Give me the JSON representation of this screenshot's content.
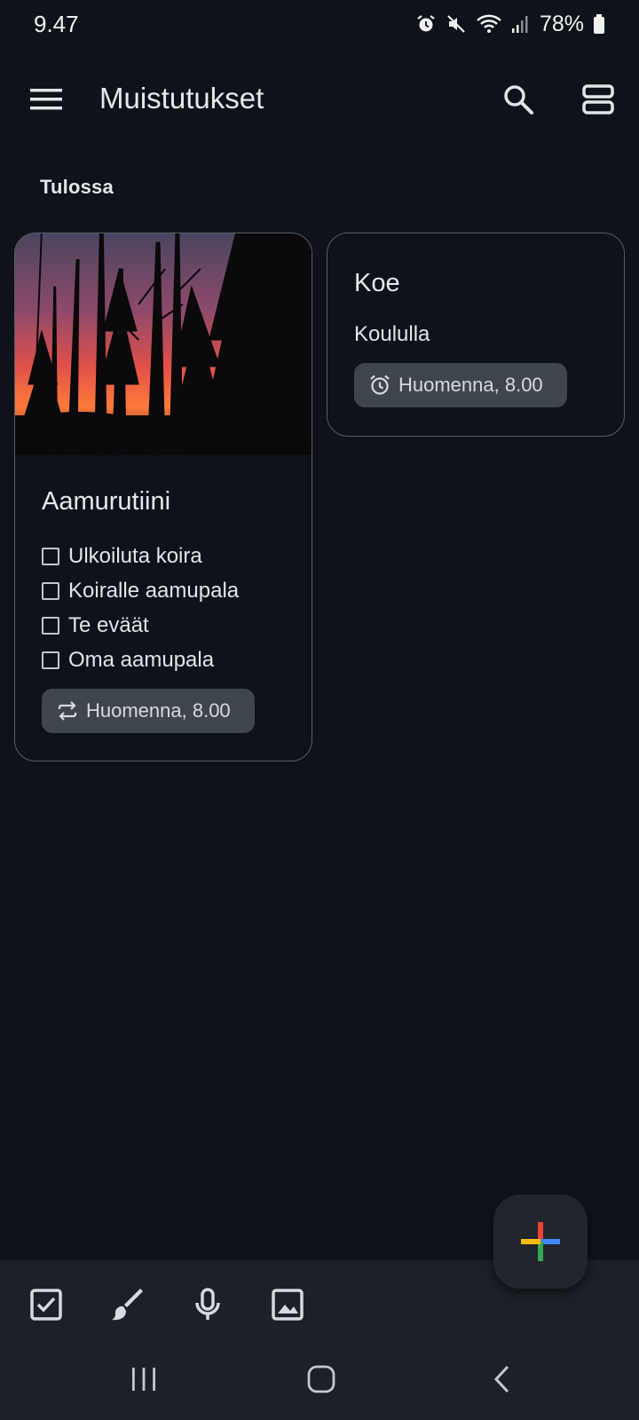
{
  "status_bar": {
    "time": "9.47",
    "battery": "78%",
    "icons": [
      "alarm-icon",
      "mute-icon",
      "wifi-icon",
      "signal-icon",
      "battery-icon"
    ]
  },
  "app_bar": {
    "title": "Muistutukset",
    "icons": [
      "menu-icon",
      "search-icon",
      "list-view-icon"
    ]
  },
  "section": {
    "label": "Tulossa"
  },
  "notes": [
    {
      "title": "Aamurutiini",
      "has_image": true,
      "checklist": [
        "Ulkoiluta koira",
        "Koiralle aamupala",
        "Te eväät",
        "Oma aamupala"
      ],
      "reminder": {
        "icon": "repeat-icon",
        "label": "Huomenna, 8.00"
      }
    },
    {
      "title": "Koe",
      "text": "Koululla",
      "reminder": {
        "icon": "alarm-icon",
        "label": "Huomenna, 8.00"
      }
    }
  ],
  "fab": {
    "icon": "plus-icon",
    "colors": [
      "#ea4335",
      "#4285f4",
      "#34a853",
      "#fbbc04"
    ]
  },
  "bottom_toolbar": {
    "icons": [
      "checkbox-icon",
      "brush-icon",
      "mic-icon",
      "image-icon"
    ]
  },
  "nav_bar": {
    "icons": [
      "recents-icon",
      "home-icon",
      "back-icon"
    ]
  }
}
